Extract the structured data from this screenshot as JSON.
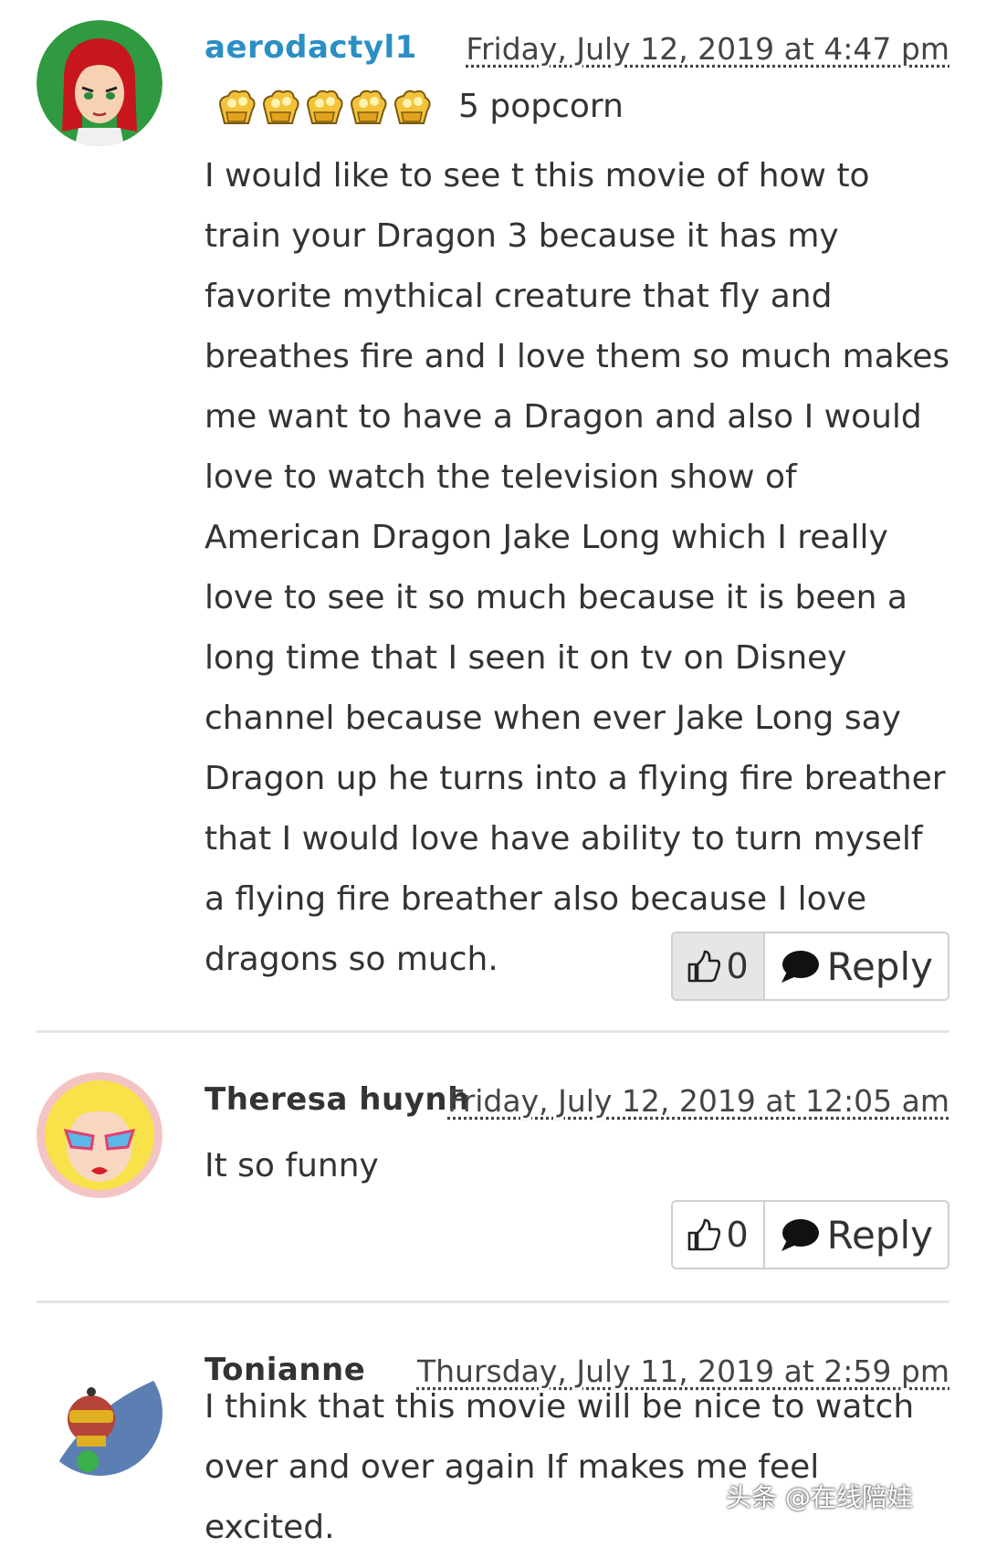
{
  "comments": [
    {
      "author": "aerodactyl1",
      "date": "Friday, July 12, 2019 at 4:47 pm",
      "rating_icon": "popcorn-icon",
      "rating_value": 5,
      "rating_text": "5 popcorn",
      "text": "I would like to see t this movie of how to train your Dragon 3 because it has my favorite mythical creature that fly and breathes fire and I love them so much makes me want to have a Dragon and also I would love to watch the television show of American Dragon Jake Long which I really love to see it so much because it is been a long time that I seen it on tv on Disney channel because when ever Jake Long say Dragon up he turns into a flying fire breather that I would love have ability to turn myself a flying fire breather also because I love dragons so much.",
      "likes": "0",
      "reply_label": "Reply"
    },
    {
      "author": "Theresa huynh",
      "date": "Friday, July 12, 2019 at 12:05 am",
      "text": "It so funny",
      "likes": "0",
      "reply_label": "Reply"
    },
    {
      "author": "Tonianne",
      "date": "Thursday, July 11, 2019 at 2:59 pm",
      "text": "I think that this movie will be nice to watch over and over again If makes me feel excited.",
      "likes": null,
      "reply_label": null
    }
  ],
  "watermark": "头条 @在线陪娃",
  "colors": {
    "author_link": "#2b8fc4",
    "text": "#333333",
    "divider": "#e4e4e4",
    "button_border": "#cfcfcf",
    "pressed_bg": "#e6e6e6"
  }
}
